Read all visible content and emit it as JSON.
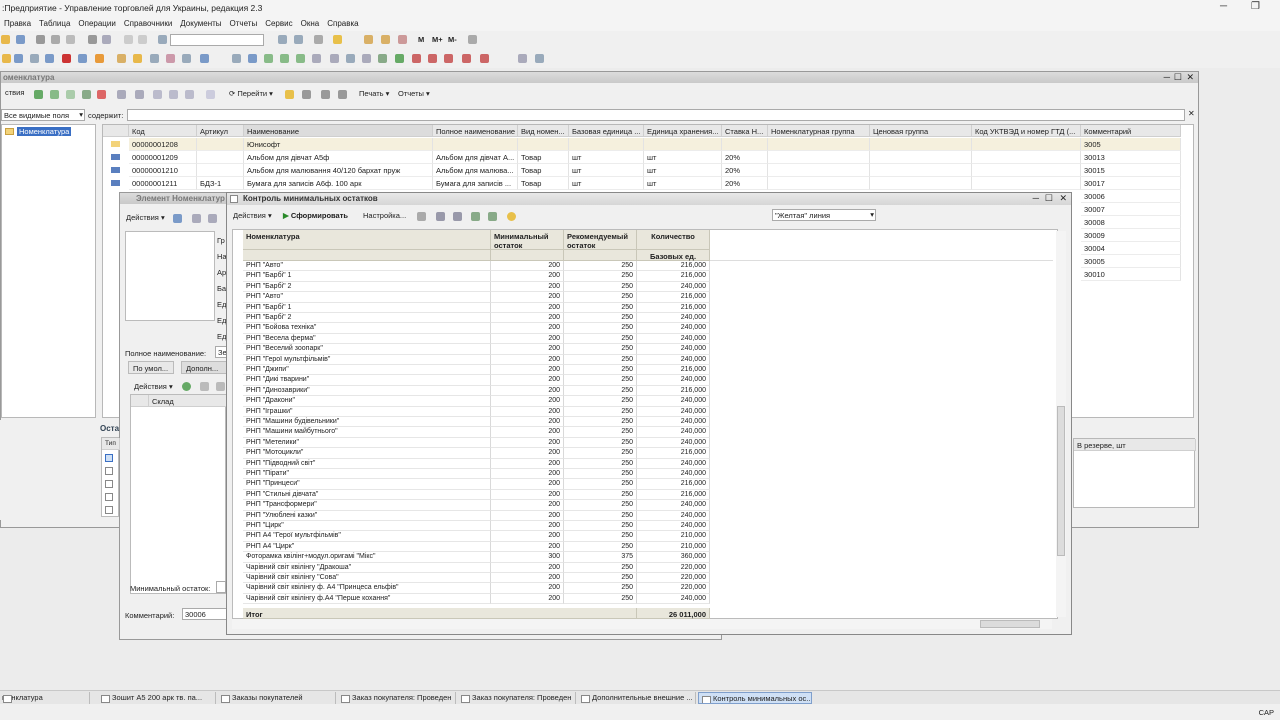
{
  "app": {
    "title": ":Предприятие - Управление торговлей для Украины, редакция 2.3",
    "status_right": "CAP"
  },
  "menu": [
    "Правка",
    "Таблица",
    "Операции",
    "Справочники",
    "Документы",
    "Отчеты",
    "Сервис",
    "Окна",
    "Справка"
  ],
  "toolbar": {
    "m": "M",
    "mplus": "M+",
    "mminus": "M-"
  },
  "nomenclature": {
    "title": "оменклатура",
    "actions": "ствия",
    "goto": "Перейти",
    "print": "Печать",
    "reports": "Отчеты",
    "filter_select": "Все видимые поля",
    "contains_label": "содержит:",
    "tree_item": "Номенклатура",
    "columns": [
      "Код",
      "Артикул",
      "Наименование",
      "Полное наименование",
      "Вид номен...",
      "Базовая единица ...",
      "Единица хранения...",
      "Ставка Н...",
      "Номенклатурная группа",
      "Ценовая группа",
      "Код УКТВЭД и номер ГТД (...",
      "Комментарий"
    ],
    "rows": [
      {
        "code": "00000001208",
        "art": "",
        "name": "Юнисофт",
        "full": "",
        "kind": "",
        "base": "",
        "store": "",
        "vat": "",
        "comment": "3005"
      },
      {
        "code": "00000001209",
        "art": "",
        "name": "Альбом для дівчат А5ф",
        "full": "Альбом для дівчат А...",
        "kind": "Товар",
        "base": "шт",
        "store": "шт",
        "vat": "20%",
        "comment": "30013"
      },
      {
        "code": "00000001210",
        "art": "",
        "name": "Альбом для малювання 40/120 бархат пруж",
        "full": "Альбом для малюва...",
        "kind": "Товар",
        "base": "шт",
        "store": "шт",
        "vat": "20%",
        "comment": "30015"
      },
      {
        "code": "00000001211",
        "art": "БДЗ-1",
        "name": "Бумага для записів А6ф. 100 арк",
        "full": "Бумага для записів ...",
        "kind": "Товар",
        "base": "шт",
        "store": "шт",
        "vat": "20%",
        "comment": "30017"
      }
    ],
    "extra_comments": [
      "30006",
      "30007",
      "30008",
      "30009",
      "30004",
      "30005",
      "30010"
    ],
    "reserve_header": "В резерве, шт"
  },
  "element": {
    "title": "Элемент Номенклатур",
    "actions": "Действия",
    "labels": [
      "Гр",
      "На",
      "Ар",
      "Ба",
      "Ед",
      "Ед",
      "Ед"
    ],
    "full_name_label": "Полное наименование:",
    "full_name_value": "Зе",
    "tab1": "По умол...",
    "tab2": "Дополн...",
    "sub_actions": "Действия",
    "warehouse_col": "Склад",
    "min_label": "Минимальный остаток:",
    "comment_label": "Комментарий:",
    "comment_value": "30006",
    "left_panel_title": "Оста",
    "left_panel_col": "Тип"
  },
  "report": {
    "title": "Контроль минимальных остатков",
    "actions": "Действия",
    "generate": "Сформировать",
    "settings": "Настройка...",
    "group_value": "\"Желтая\" линия",
    "headers": {
      "name": "Номенклатура",
      "min": "Минимальный остаток",
      "rec": "Рекомендуемый остаток",
      "qty": "Количество",
      "base": "Базовых ед."
    },
    "rows": [
      [
        "РНП \"Авто\"",
        "200",
        "250",
        "216,000"
      ],
      [
        "РНП \"Барбі\" 1",
        "200",
        "250",
        "216,000"
      ],
      [
        "РНП \"Барбі\" 2",
        "200",
        "250",
        "240,000"
      ],
      [
        "РНП \"Авто\"",
        "200",
        "250",
        "216,000"
      ],
      [
        "РНП \"Барбі\" 1",
        "200",
        "250",
        "216,000"
      ],
      [
        "РНП \"Барбі\" 2",
        "200",
        "250",
        "240,000"
      ],
      [
        "РНП \"Бойова техніка\"",
        "200",
        "250",
        "240,000"
      ],
      [
        "РНП \"Весела ферма\"",
        "200",
        "250",
        "240,000"
      ],
      [
        "РНП \"Веселий зоопарк\"",
        "200",
        "250",
        "240,000"
      ],
      [
        "РНП \"Герої мультфільмів\"",
        "200",
        "250",
        "240,000"
      ],
      [
        "РНП \"Джипи\"",
        "200",
        "250",
        "216,000"
      ],
      [
        "РНП \"Дикі тварини\"",
        "200",
        "250",
        "240,000"
      ],
      [
        "РНП \"Динозаврики\"",
        "200",
        "250",
        "216,000"
      ],
      [
        "РНП \"Дракони\"",
        "200",
        "250",
        "240,000"
      ],
      [
        "РНП \"Іграшки\"",
        "200",
        "250",
        "240,000"
      ],
      [
        "РНП \"Машини будівельники\"",
        "200",
        "250",
        "240,000"
      ],
      [
        "РНП \"Машини майбутнього\"",
        "200",
        "250",
        "240,000"
      ],
      [
        "РНП \"Метелики\"",
        "200",
        "250",
        "240,000"
      ],
      [
        "РНП \"Мотоцикли\"",
        "200",
        "250",
        "216,000"
      ],
      [
        "РНП \"Підводний світ\"",
        "200",
        "250",
        "240,000"
      ],
      [
        "РНП \"Пірати\"",
        "200",
        "250",
        "240,000"
      ],
      [
        "РНП \"Принцеси\"",
        "200",
        "250",
        "216,000"
      ],
      [
        "РНП \"Стильні дівчата\"",
        "200",
        "250",
        "216,000"
      ],
      [
        "РНП \"Трансформери\"",
        "200",
        "250",
        "240,000"
      ],
      [
        "РНП \"Улюблені казки\"",
        "200",
        "250",
        "240,000"
      ],
      [
        "РНП \"Цирк\"",
        "200",
        "250",
        "240,000"
      ],
      [
        "РНП А4 \"Герої мультфільмів\"",
        "200",
        "250",
        "210,000"
      ],
      [
        "РНП А4 \"Цирк\"",
        "200",
        "250",
        "210,000"
      ],
      [
        "Фоторамка квілінг+модул.оригамі \"Мікс\"",
        "300",
        "375",
        "360,000"
      ],
      [
        "Чарівний світ квілінгу \"Дракоша\"",
        "200",
        "250",
        "220,000"
      ],
      [
        "Чарівний світ квілінгу \"Сова\"",
        "200",
        "250",
        "220,000"
      ],
      [
        "Чарівний світ квілінгу ф. А4 \"Принцеса ельфів\"",
        "200",
        "250",
        "220,000"
      ],
      [
        "Чарівний світ квілінгу ф.А4 \"Перше кохання\"",
        "200",
        "250",
        "240,000"
      ]
    ],
    "total_label": "Итог",
    "total_value": "26 011,000"
  },
  "taskbar": [
    "менклатура",
    "Зошит А5 200 арк тв. па...",
    "Заказы покупателей",
    "Заказ покупателя: Проведен",
    "Заказ покупателя: Проведен",
    "Дополнительные внешние ...",
    "Контроль минимальных ос..."
  ]
}
